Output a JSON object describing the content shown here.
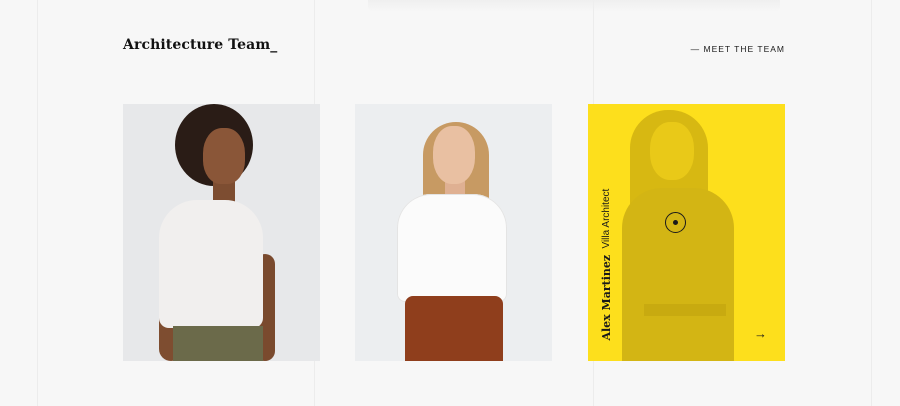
{
  "header": {
    "title": "Architecture Team_",
    "link_label": "— MEET THE TEAM"
  },
  "team": [
    {
      "card": "team-card-1"
    },
    {
      "card": "team-card-2"
    },
    {
      "card": "team-card-3",
      "name": "Alex Martinez",
      "role": "Villa Architect",
      "accent": "#fddf1c",
      "icons": [
        "target-icon",
        "arrow-right-icon"
      ]
    }
  ],
  "arrow_glyph": "→"
}
